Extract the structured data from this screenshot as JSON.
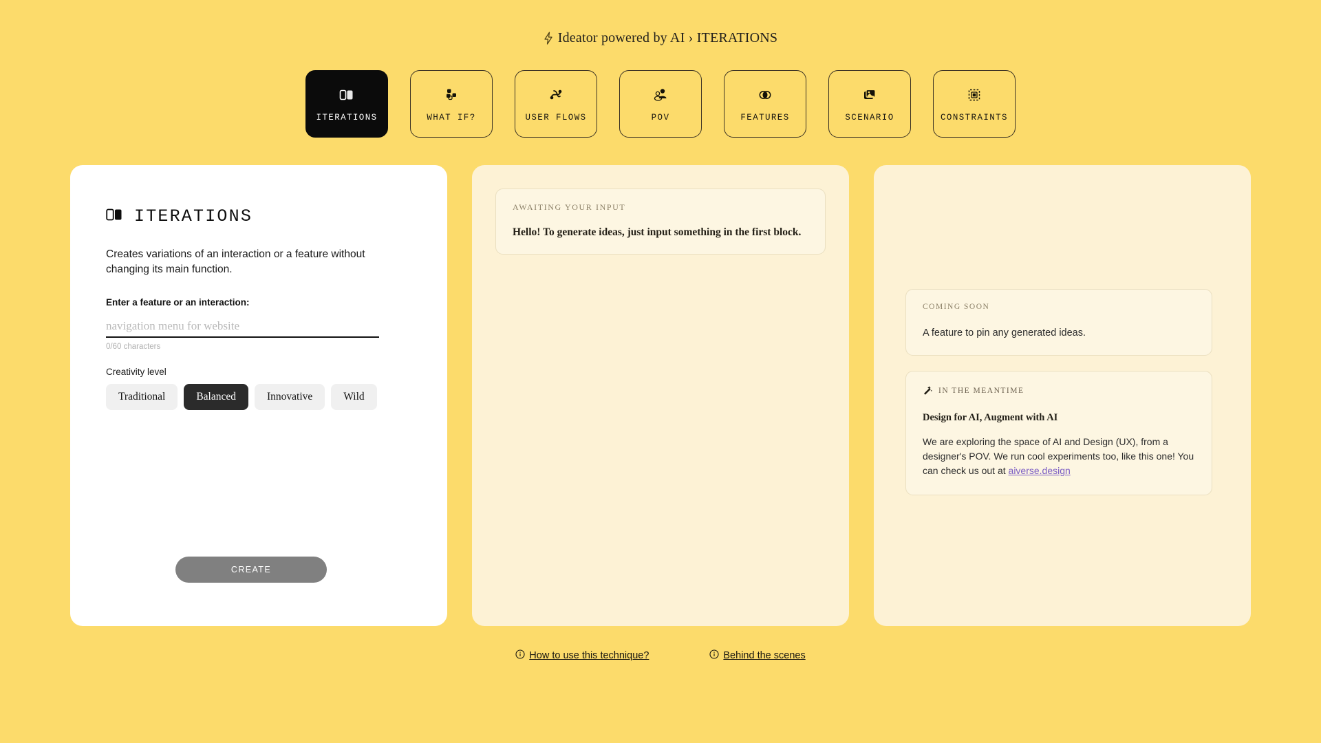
{
  "header": {
    "icon": "bolt-icon",
    "title": "Ideator powered by AI › ITERATIONS"
  },
  "tabs": [
    {
      "label": "ITERATIONS",
      "icon": "iterations-icon",
      "active": true
    },
    {
      "label": "WHAT IF?",
      "icon": "what-if-icon",
      "active": false
    },
    {
      "label": "USER FLOWS",
      "icon": "user-flows-icon",
      "active": false
    },
    {
      "label": "POV",
      "icon": "pov-icon",
      "active": false
    },
    {
      "label": "FEATURES",
      "icon": "features-icon",
      "active": false
    },
    {
      "label": "SCENARIO",
      "icon": "scenario-icon",
      "active": false
    },
    {
      "label": "CONSTRAINTS",
      "icon": "constraints-icon",
      "active": false
    }
  ],
  "left_panel": {
    "icon": "iterations-icon",
    "title": "ITERATIONS",
    "description": "Creates variations of an interaction or a feature without changing its main function.",
    "input_label": "Enter a feature or an interaction:",
    "input_value": "",
    "input_placeholder": "navigation menu for website",
    "char_count": "0/60 characters",
    "creativity_label": "Creativity level",
    "creativity_options": [
      {
        "label": "Traditional",
        "selected": false
      },
      {
        "label": "Balanced",
        "selected": true
      },
      {
        "label": "Innovative",
        "selected": false
      },
      {
        "label": "Wild",
        "selected": false
      }
    ],
    "create_button": "CREATE"
  },
  "middle_panel": {
    "kicker": "AWAITING YOUR INPUT",
    "message": "Hello! To generate ideas, just input something in the first block."
  },
  "right_panel": {
    "coming_soon": {
      "kicker": "COMING SOON",
      "body": "A feature to pin any generated ideas."
    },
    "meantime": {
      "icon": "magic-wand-icon",
      "kicker": "IN THE MEANTIME",
      "title": "Design for AI, Augment with AI",
      "body_before_link": "We are exploring the space of AI and Design (UX), from a designer's POV. We run cool experiments too, like this one! You can check us out at ",
      "link": "aiverse.design"
    }
  },
  "footer": {
    "links": [
      {
        "label": "How to use this technique?",
        "icon": "info-circle-icon"
      },
      {
        "label": "Behind the scenes",
        "icon": "info-circle-icon"
      }
    ]
  },
  "colors": {
    "background": "#FCDB6B",
    "panel_cream": "#FDF2D5",
    "panel_white": "#FFFFFF",
    "active_tab": "#0B0B0B",
    "link_purple": "#7A5CC4",
    "create_disabled": "#808080"
  }
}
